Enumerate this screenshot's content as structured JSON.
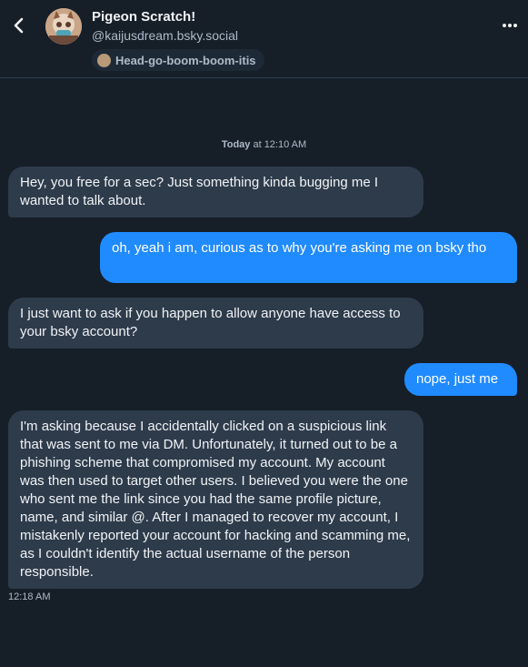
{
  "header": {
    "title": "Pigeon Scratch!",
    "handle": "@kaijusdream.bsky.social",
    "label": "Head-go-boom-boom-itis"
  },
  "conversation": {
    "date_prefix": "Today",
    "date_time": " at 12:10 AM",
    "messages": [
      {
        "from": "them",
        "text": "Hey, you free for a sec? Just something kinda bugging me I wanted to talk about."
      },
      {
        "from": "me",
        "text": "oh, yeah i am, curious as to why you're asking me on bsky tho"
      },
      {
        "from": "them",
        "text": "I just want to ask if you happen to allow anyone have access to your bsky account?"
      },
      {
        "from": "me",
        "text": "nope, just me"
      },
      {
        "from": "them",
        "text": "I'm asking because I accidentally clicked on a suspicious link that was sent to me via DM. Unfortunately, it turned out to be a phishing scheme that compromised my account. My account was then used to target other users. I believed you were the one who sent me the link since you had the same profile picture, name, and similar @. After I managed to recover my account, I mistakenly reported your account for hacking and scamming me, as I couldn't identify the actual username of the person responsible."
      }
    ],
    "last_message_time": "12:18 AM"
  },
  "icons": {
    "back": "chevron-left-icon",
    "more": "more-horizontal-icon",
    "label": "label-avatar-icon"
  },
  "colors": {
    "background": "#161e27",
    "incoming_bubble": "#2e3b4b",
    "outgoing_bubble": "#208bfe",
    "secondary_text": "#aebbc9"
  }
}
